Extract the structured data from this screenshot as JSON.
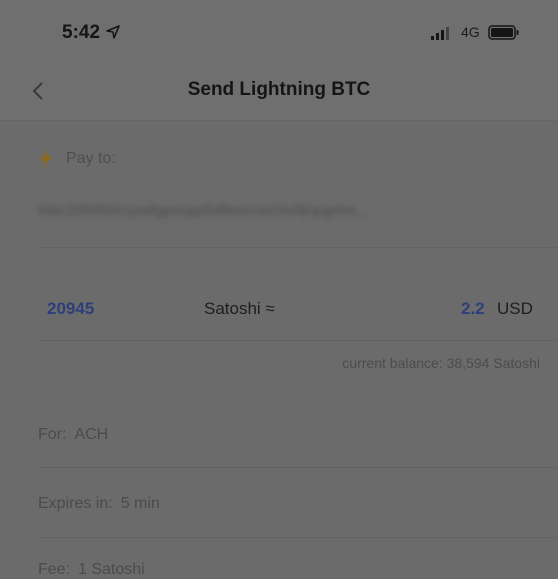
{
  "status_bar": {
    "time": "5:42",
    "network": "4G",
    "icons": [
      "location-arrow-icon",
      "signal-icon",
      "battery-icon"
    ]
  },
  "nav": {
    "title": "Send Lightning BTC",
    "back_icon": "chevron-left-icon"
  },
  "pay_to": {
    "icon": "lightning-bolt-icon",
    "label": "Pay to:",
    "address": "lnbc209450n1pwfgpvupp5d8excrw24u9jnpgetm..."
  },
  "amount": {
    "value": "20945",
    "unit": "Satoshi ≈",
    "usd_value": "2.2",
    "usd_currency": "USD"
  },
  "balance": {
    "text": "current balance: 38,594 Satoshi"
  },
  "details": {
    "for_label": "For:",
    "for_value": "ACH",
    "expires_label": "Expires in:",
    "expires_value": "5 min",
    "fee_label": "Fee:",
    "fee_value": "1 Satoshi"
  },
  "colors": {
    "accent": "#2c3f7a",
    "bolt": "#8a6a1e",
    "background": "#6b6b6b"
  }
}
